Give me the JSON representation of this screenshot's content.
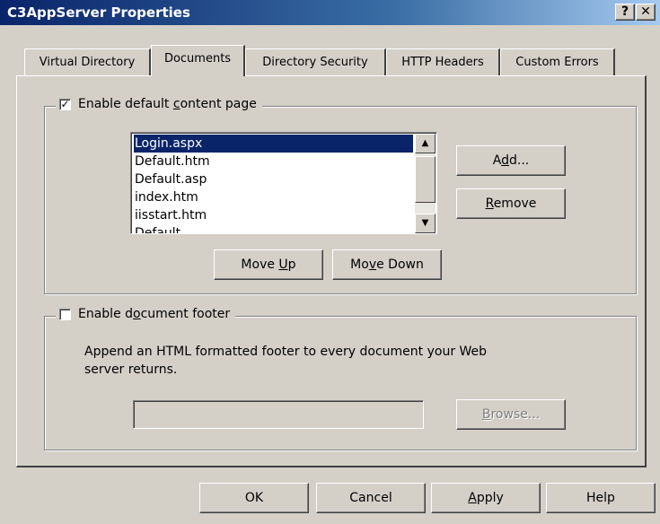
{
  "window": {
    "title": "C3AppServer Properties",
    "help_button": "?",
    "close_button": "✕"
  },
  "tabs": [
    {
      "label": "Virtual Directory",
      "active": false
    },
    {
      "label": "Documents",
      "active": true
    },
    {
      "label": "Directory Security",
      "active": false
    },
    {
      "label": "HTTP Headers",
      "active": false
    },
    {
      "label": "Custom Errors",
      "active": false
    }
  ],
  "default_content": {
    "checked": true,
    "label_pre": "Enable default ",
    "label_accel": "c",
    "label_post": "ontent page",
    "documents": [
      "Login.aspx",
      "Default.htm",
      "Default.asp",
      "index.htm",
      "iisstart.htm",
      "Default..."
    ],
    "selected_index": 0,
    "add_pre": "A",
    "add_accel": "d",
    "add_post": "d...",
    "remove_pre": "",
    "remove_accel": "R",
    "remove_post": "emove",
    "moveup_pre": "Move ",
    "moveup_accel": "U",
    "moveup_post": "p",
    "movedown_pre": "Mo",
    "movedown_accel": "v",
    "movedown_post": "e Down"
  },
  "footer": {
    "checked": false,
    "label_pre": "Enable d",
    "label_accel": "o",
    "label_post": "cument footer",
    "description_line1": "Append an HTML formatted footer to every document your Web",
    "description_line2": "server returns.",
    "path_value": "",
    "browse_pre": "",
    "browse_accel": "B",
    "browse_post": "rowse..."
  },
  "buttons": {
    "ok": "OK",
    "cancel": "Cancel",
    "apply_accel": "A",
    "apply_post": "pply",
    "help": "Help"
  }
}
